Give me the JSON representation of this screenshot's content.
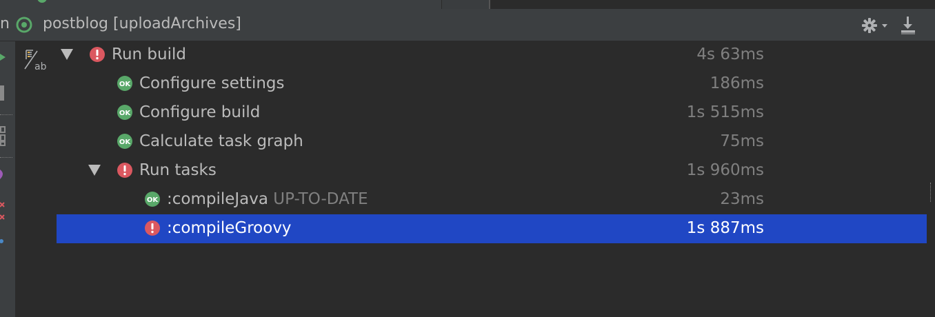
{
  "header": {
    "fragment": "n",
    "title": "postblog [uploadArchives]",
    "settings_icon": "gear-icon",
    "download_icon": "download-icon"
  },
  "tree": {
    "toggle_icon": "sort-ab-icon",
    "rows": [
      {
        "label": "Run build",
        "suffix": "",
        "time": "4s 63ms",
        "status": "error",
        "expanded": true,
        "selected": false
      },
      {
        "label": "Configure settings",
        "suffix": "",
        "time": "186ms",
        "status": "ok",
        "selected": false
      },
      {
        "label": "Configure build",
        "suffix": "",
        "time": "1s 515ms",
        "status": "ok",
        "selected": false
      },
      {
        "label": "Calculate task graph",
        "suffix": "",
        "time": "75ms",
        "status": "ok",
        "selected": false
      },
      {
        "label": "Run tasks",
        "suffix": "",
        "time": "1s 960ms",
        "status": "error",
        "expanded": true,
        "selected": false
      },
      {
        "label": ":compileJava",
        "suffix": "UP-TO-DATE",
        "time": "23ms",
        "status": "ok",
        "selected": false
      },
      {
        "label": ":compileGroovy",
        "suffix": "",
        "time": "1s 887ms",
        "status": "error",
        "selected": true
      }
    ]
  },
  "colors": {
    "background": "#2b2b2b",
    "panel": "#3c3f41",
    "selection": "#2047c4",
    "ok": "#59a869",
    "error": "#db5860"
  }
}
